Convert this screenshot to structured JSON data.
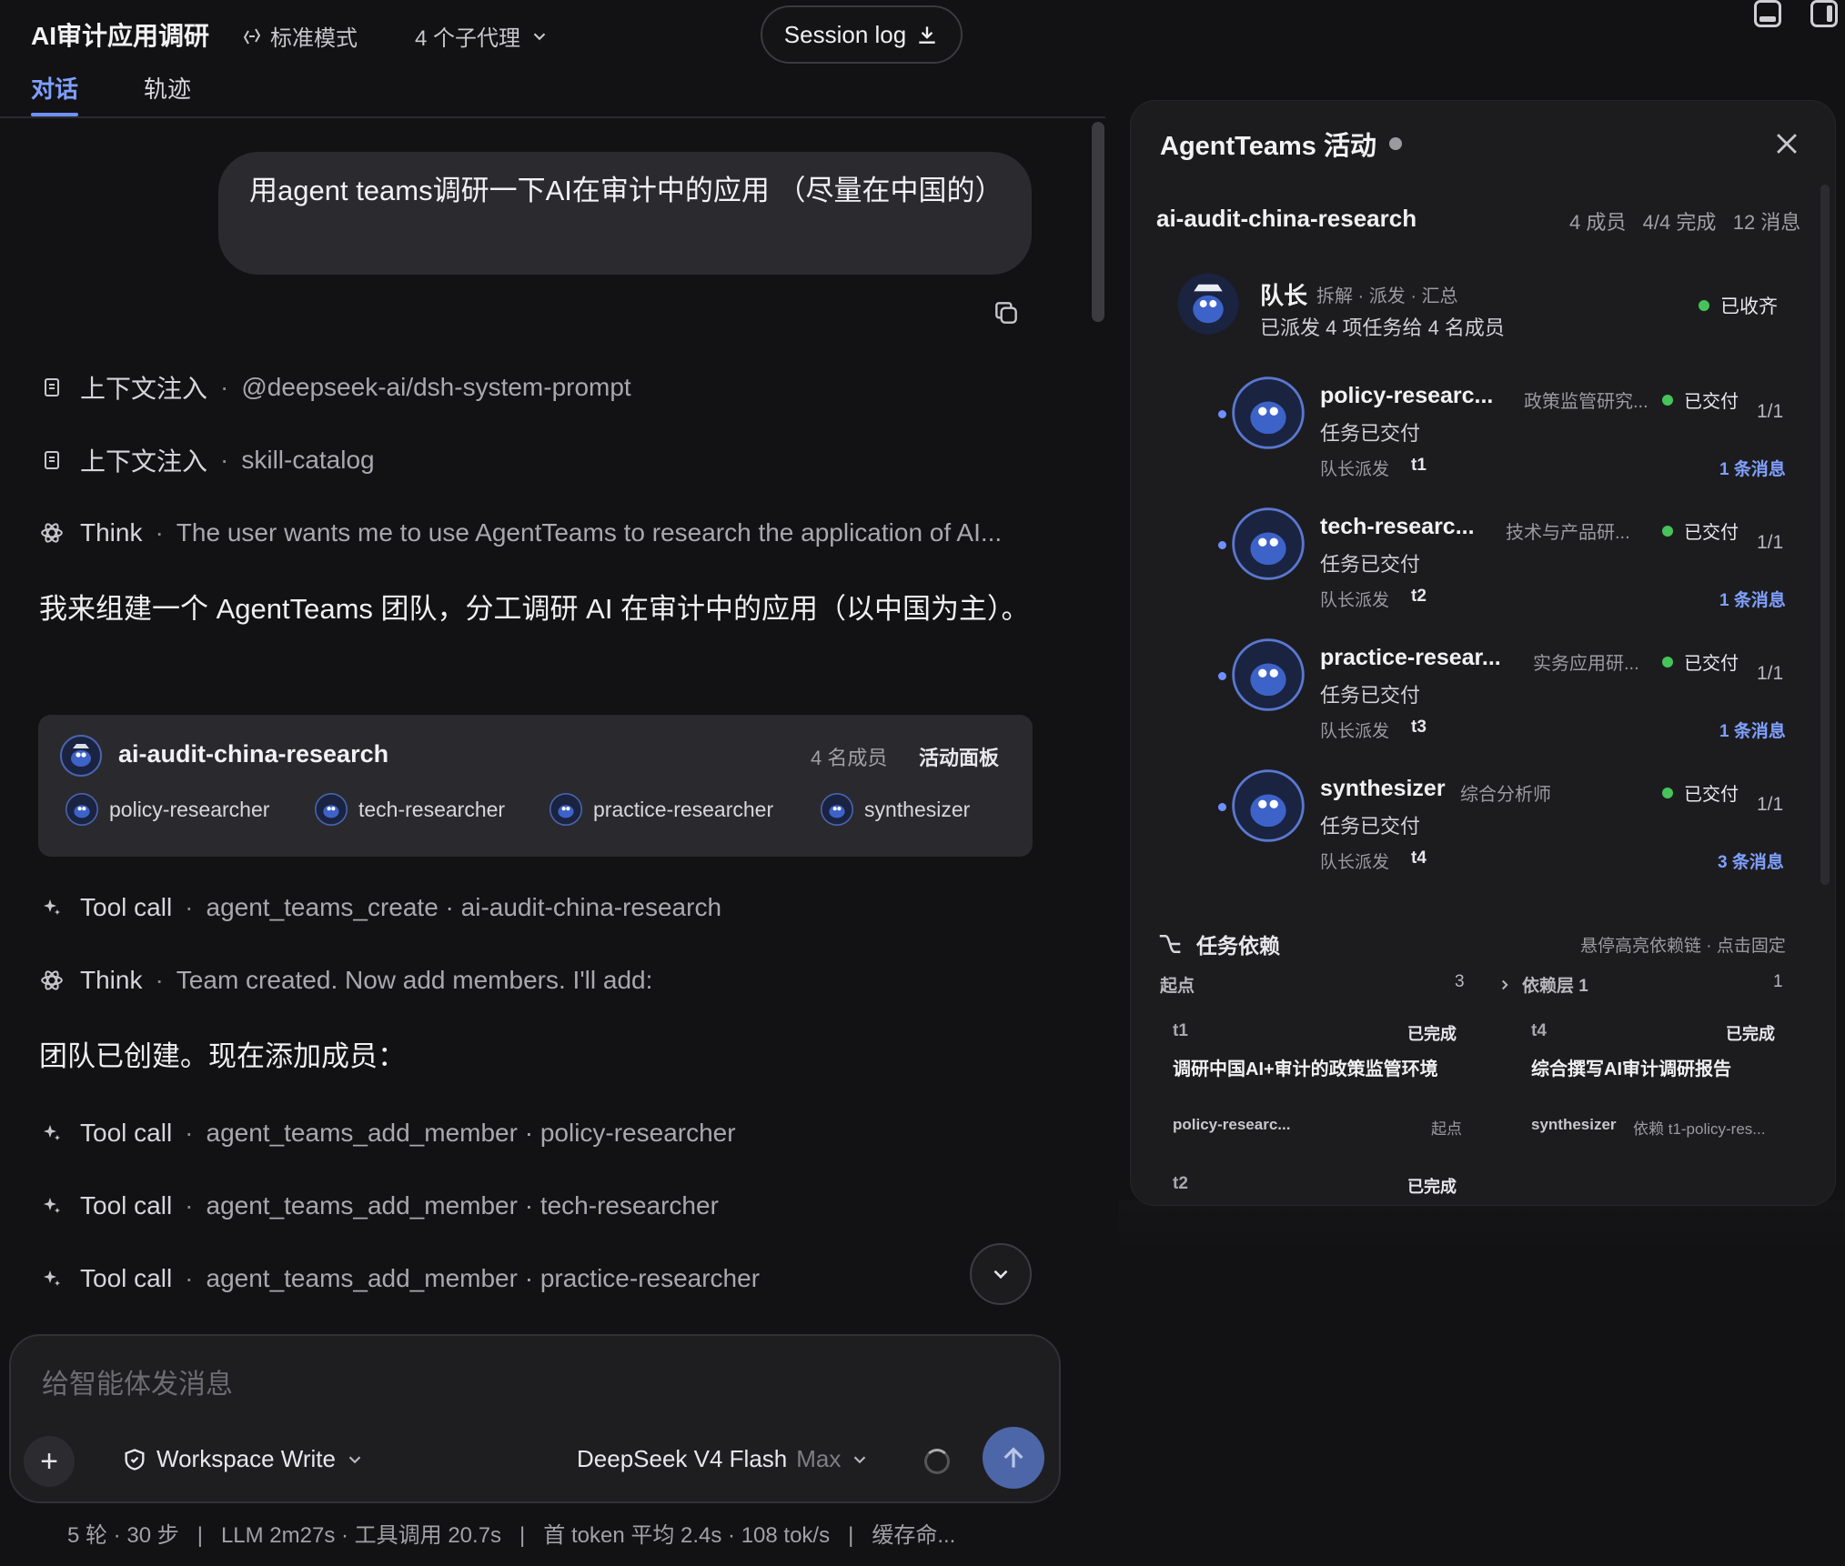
{
  "header": {
    "title": "AI审计应用调研",
    "mode": "标准模式",
    "subagents": "4 个子代理",
    "session_log": "Session log",
    "tabs": [
      "对话",
      "轨迹"
    ]
  },
  "chat": {
    "user_message": "用agent teams调研一下AI在审计中的应用 （尽量在中国的）",
    "activities_top": [
      {
        "kind": "上下文注入",
        "detail": "@deepseek-ai/dsh-system-prompt"
      },
      {
        "kind": "上下文注入",
        "detail": "skill-catalog"
      },
      {
        "kind": "Think",
        "detail": "The user wants me to use AgentTeams to research the application of AI..."
      }
    ],
    "assistant_text_1": "我来组建一个 AgentTeams 团队，分工调研 AI 在审计中的应用（以中国为主）。",
    "team_card": {
      "name": "ai-audit-china-research",
      "member_count": "4 名成员",
      "panel_link": "活动面板",
      "members": [
        "policy-researcher",
        "tech-researcher",
        "practice-researcher",
        "synthesizer"
      ]
    },
    "activities_mid": [
      {
        "kind": "Tool call",
        "detail": "agent_teams_create · ai-audit-china-research"
      },
      {
        "kind": "Think",
        "detail": "Team created. Now add members. I'll add:"
      }
    ],
    "assistant_text_2": "团队已创建。现在添加成员：",
    "activities_bottom": [
      {
        "kind": "Tool call",
        "detail": "agent_teams_add_member · policy-researcher"
      },
      {
        "kind": "Tool call",
        "detail": "agent_teams_add_member · tech-researcher"
      },
      {
        "kind": "Tool call",
        "detail": "agent_teams_add_member · practice-researcher"
      }
    ]
  },
  "composer": {
    "placeholder": "给智能体发消息",
    "workspace": "Workspace Write",
    "model": "DeepSeek V4 Flash",
    "model_level": "Max"
  },
  "statusbar": "5 轮 · 30 步   |   LLM 2m27s · 工具调用 20.7s   |   首 token 平均 2.4s · 108 tok/s   |   缓存命...",
  "panel": {
    "title": "AgentTeams 活动",
    "team": "ai-audit-china-research",
    "stats": "4 成员   4/4 完成   12 消息",
    "lead": {
      "name": "队长",
      "role": "拆解 · 派发 · 汇总",
      "desc": "已派发 4 项任务给 4 名成员",
      "status": "已收齐"
    },
    "members": [
      {
        "name": "policy-researc...",
        "role": "政策监管研究...",
        "status": "已交付",
        "frac": "1/1",
        "sub": "任务已交付",
        "dispatch": "队长派发",
        "task": "t1",
        "msgs": "1 条消息"
      },
      {
        "name": "tech-researc...",
        "role": "技术与产品研...",
        "status": "已交付",
        "frac": "1/1",
        "sub": "任务已交付",
        "dispatch": "队长派发",
        "task": "t2",
        "msgs": "1 条消息"
      },
      {
        "name": "practice-resear...",
        "role": "实务应用研...",
        "status": "已交付",
        "frac": "1/1",
        "sub": "任务已交付",
        "dispatch": "队长派发",
        "task": "t3",
        "msgs": "1 条消息"
      },
      {
        "name": "synthesizer",
        "role": "综合分析师",
        "status": "已交付",
        "frac": "1/1",
        "sub": "任务已交付",
        "dispatch": "队长派发",
        "task": "t4",
        "msgs": "3 条消息"
      }
    ],
    "deps": {
      "title": "任务依赖",
      "hint": "悬停高亮依赖链 · 点击固定",
      "col1": {
        "label": "起点",
        "count": "3"
      },
      "col2": {
        "label": "依赖层 1",
        "count": "1"
      },
      "t1": {
        "id": "t1",
        "status": "已完成",
        "title": "调研中国AI+审计的政策监管环境",
        "owner": "policy-researc...",
        "dep": "起点"
      },
      "t4": {
        "id": "t4",
        "status": "已完成",
        "title": "综合撰写AI审计调研报告",
        "owner": "synthesizer",
        "dep": "依赖 t1-policy-res..."
      },
      "t2": {
        "id": "t2",
        "status": "已完成"
      }
    }
  },
  "colors": {
    "accent": "#6f8fff",
    "success": "#46c35a",
    "send": "#4d66a8"
  }
}
